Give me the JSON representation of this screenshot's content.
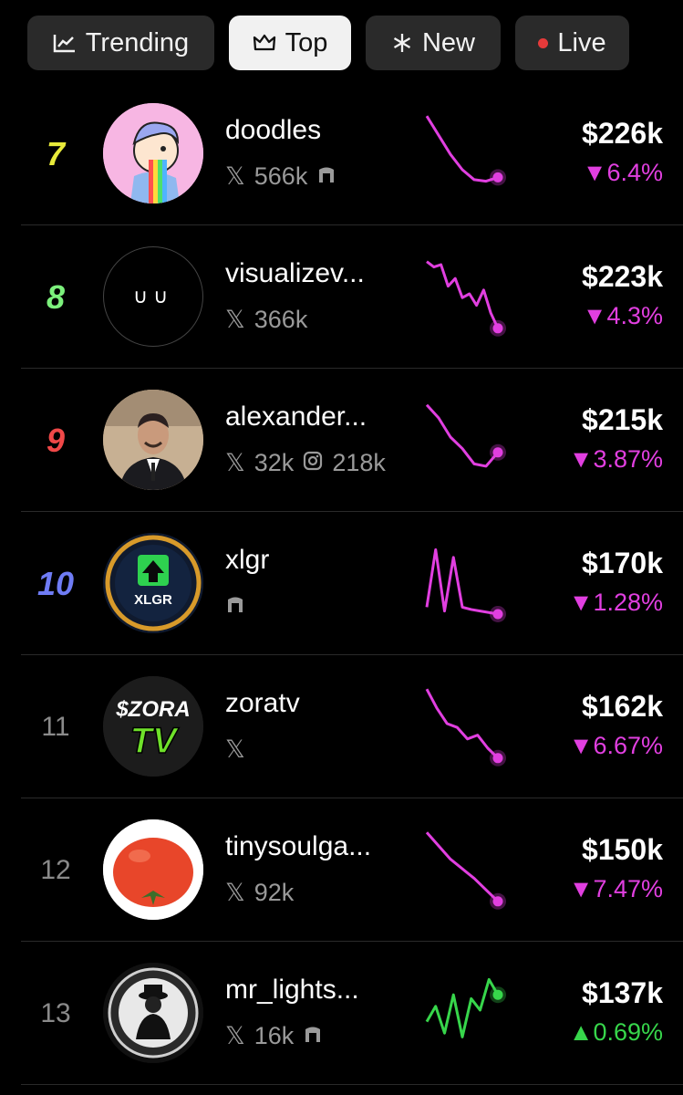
{
  "tabs": [
    {
      "label": "Trending",
      "icon": "chart-line-icon",
      "active": false
    },
    {
      "label": "Top",
      "icon": "crown-icon",
      "active": true
    },
    {
      "label": "New",
      "icon": "asterisk-icon",
      "active": false
    },
    {
      "label": "Live",
      "icon": "live-dot-icon",
      "active": false
    }
  ],
  "colors": {
    "negative": "#e13fe0",
    "positive": "#37d64b",
    "live_dot": "#e53a3a"
  },
  "rows": [
    {
      "rank": "7",
      "name": "doodles",
      "x_followers": "566k",
      "extra_icon": "gate-icon",
      "ig_followers": "",
      "price": "$226k",
      "change": "6.4%",
      "direction": "down",
      "spark": [
        0.95,
        0.7,
        0.45,
        0.25,
        0.12,
        0.1,
        0.15
      ]
    },
    {
      "rank": "8",
      "name": "visualizev...",
      "x_followers": "366k",
      "extra_icon": "",
      "ig_followers": "",
      "price": "$223k",
      "change": "4.3%",
      "direction": "down",
      "spark": [
        0.92,
        0.85,
        0.88,
        0.6,
        0.7,
        0.45,
        0.5,
        0.35,
        0.55,
        0.25,
        0.05
      ]
    },
    {
      "rank": "9",
      "name": "alexander...",
      "x_followers": "32k",
      "extra_icon": "instagram-icon",
      "ig_followers": "218k",
      "price": "$215k",
      "change": "3.87%",
      "direction": "down",
      "spark": [
        0.92,
        0.75,
        0.5,
        0.35,
        0.15,
        0.12,
        0.3
      ]
    },
    {
      "rank": "10",
      "name": "xlgr",
      "x_followers": "",
      "extra_icon": "gate-icon",
      "ig_followers": "",
      "price": "$170k",
      "change": "1.28%",
      "direction": "down",
      "spark": [
        0.15,
        0.9,
        0.1,
        0.8,
        0.15,
        0.12,
        0.1,
        0.08,
        0.06
      ]
    },
    {
      "rank": "11",
      "name": "zoratv",
      "x_followers": "",
      "extra_icon": "",
      "ig_followers": "",
      "price": "$162k",
      "change": "6.67%",
      "direction": "down",
      "spark": [
        0.95,
        0.7,
        0.5,
        0.45,
        0.3,
        0.35,
        0.18,
        0.05
      ]
    },
    {
      "rank": "12",
      "name": "tinysoulga...",
      "x_followers": "92k",
      "extra_icon": "",
      "ig_followers": "",
      "price": "$150k",
      "change": "7.47%",
      "direction": "down",
      "spark": [
        0.95,
        0.6,
        0.35,
        0.05
      ]
    },
    {
      "rank": "13",
      "name": "mr_lights...",
      "x_followers": "16k",
      "extra_icon": "gate-icon",
      "ig_followers": "",
      "price": "$137k",
      "change": "0.69%",
      "direction": "up",
      "spark": [
        0.35,
        0.55,
        0.2,
        0.7,
        0.15,
        0.65,
        0.5,
        0.9,
        0.7
      ]
    }
  ]
}
